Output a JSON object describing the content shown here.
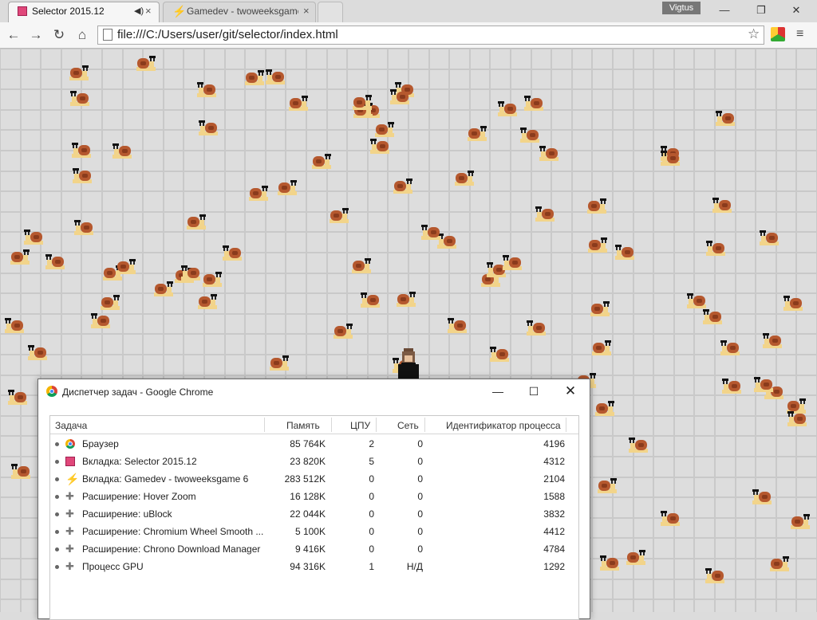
{
  "browser": {
    "tabs": [
      {
        "title": "Selector 2015.12",
        "active": true,
        "favicon": "selector-favicon",
        "audio": true
      },
      {
        "title": "Gamedev - twoweeksgame",
        "active": false,
        "favicon": "lightning-icon"
      }
    ],
    "profile_name": "Vigtus",
    "url": "file:///C:/Users/user/git/selector/index.html"
  },
  "task_manager": {
    "title": "Диспетчер задач - Google Chrome",
    "columns": [
      "Задача",
      "Память",
      "ЦПУ",
      "Сеть",
      "Идентификатор процесса"
    ],
    "rows": [
      {
        "icon": "chrome",
        "name": "Браузер",
        "memory": "85 764K",
        "cpu": "2",
        "network": "0",
        "pid": "4196"
      },
      {
        "icon": "selector",
        "name": "Вкладка: Selector 2015.12",
        "memory": "23 820K",
        "cpu": "5",
        "network": "0",
        "pid": "4312"
      },
      {
        "icon": "bolt",
        "name": "Вкладка: Gamedev - twoweeksgame 6",
        "memory": "283 512K",
        "cpu": "0",
        "network": "0",
        "pid": "2104"
      },
      {
        "icon": "puzzle",
        "name": "Расширение: Hover Zoom",
        "memory": "16 128K",
        "cpu": "0",
        "network": "0",
        "pid": "1588"
      },
      {
        "icon": "puzzle",
        "name": "Расширение: uBlock",
        "memory": "22 044K",
        "cpu": "0",
        "network": "0",
        "pid": "3832"
      },
      {
        "icon": "puzzle",
        "name": "Расширение: Chromium Wheel Smooth ...",
        "memory": "5 100K",
        "cpu": "0",
        "network": "0",
        "pid": "4412"
      },
      {
        "icon": "puzzle",
        "name": "Расширение: Chrono Download Manager",
        "memory": "9 416K",
        "cpu": "0",
        "network": "0",
        "pid": "4784"
      },
      {
        "icon": "puzzle",
        "name": "Процесс GPU",
        "memory": "94 316K",
        "cpu": "1",
        "network": "Н/Д",
        "pid": "1292"
      }
    ]
  },
  "game": {
    "snail_count": 120,
    "colors": {
      "floor": "#dddddd",
      "grid_line": "#c9c9c9",
      "snail_shell": "#b5582e",
      "snail_body": "#f2d48a"
    }
  }
}
